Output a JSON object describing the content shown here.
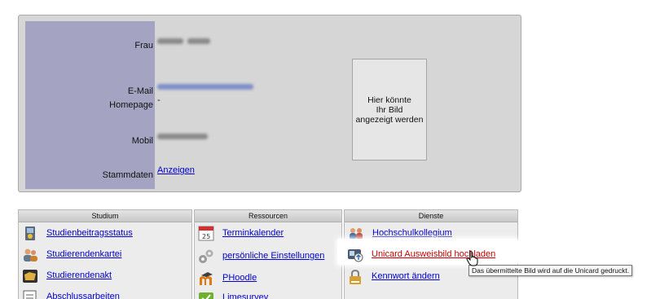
{
  "profile": {
    "salutation_label": "Frau",
    "email_label": "E-Mail",
    "homepage_label": "Homepage",
    "homepage_value": "-",
    "mobile_label": "Mobil",
    "master_data_label": "Stammdaten",
    "master_data_link": "Anzeigen",
    "photo_placeholder": "Hier könnte\nIhr Bild\nangezeigt werden"
  },
  "columns": [
    {
      "header": "Studium",
      "items": [
        {
          "label": "Studienbeitragsstatus",
          "icon": "id-card-icon"
        },
        {
          "label": "Studierendenkartei",
          "icon": "students-icon"
        },
        {
          "label": "Studierendenakt",
          "icon": "folder-icon"
        },
        {
          "label": "Abschlussarbeiten",
          "icon": "document-icon"
        }
      ]
    },
    {
      "header": "Ressourcen",
      "items": [
        {
          "label": "Terminkalender",
          "icon": "calendar-icon"
        },
        {
          "label": "persönliche Einstellungen",
          "icon": "gears-icon"
        },
        {
          "label": "PHoodle",
          "icon": "moodle-icon"
        },
        {
          "label": "Limesurvey",
          "icon": "survey-icon"
        }
      ]
    },
    {
      "header": "Dienste",
      "items": [
        {
          "label": "Hochschulkollegium",
          "icon": "people-icon"
        },
        {
          "label": "Unicard Ausweisbild hochladen",
          "icon": "card-upload-icon"
        },
        {
          "label": "Kennwort ändern",
          "icon": "padlock-icon"
        }
      ]
    }
  ],
  "tooltip": "Das übermittelte Bild wird auf die Unicard gedruckt.",
  "colors": {
    "link": "#0000cc",
    "hover_link": "#cc0000",
    "label_column": "#a4a4c2",
    "panel": "#d6d6d6"
  }
}
